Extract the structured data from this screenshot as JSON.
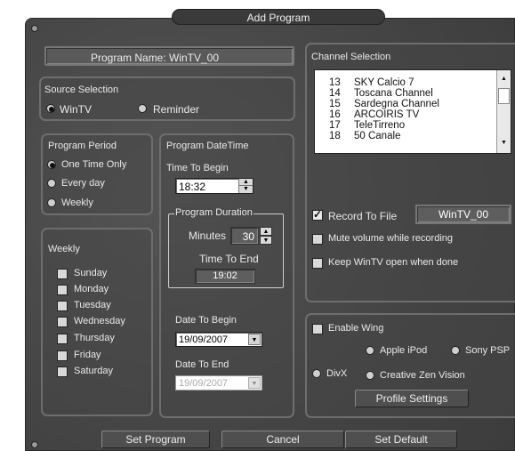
{
  "title": "Add Program",
  "program_name": {
    "label": "Program Name:",
    "value": "WinTV_00"
  },
  "source": {
    "title": "Source Selection",
    "options": [
      "WinTV",
      "Reminder"
    ],
    "selected": "WinTV"
  },
  "period": {
    "title": "Program Period",
    "options": [
      "One Time Only",
      "Every day",
      "Weekly"
    ],
    "selected": "One Time Only"
  },
  "weekly": {
    "title": "Weekly",
    "days": [
      "Sunday",
      "Monday",
      "Tuesday",
      "Wednesday",
      "Thursday",
      "Friday",
      "Saturday"
    ]
  },
  "datetime": {
    "title": "Program DateTime",
    "time_label": "Time To Begin",
    "time_value": "18:32",
    "duration_title": "Program Duration",
    "minutes_label": "Minutes",
    "minutes_value": "30",
    "end_label": "Time To End",
    "end_value": "19:02",
    "date_begin_label": "Date To Begin",
    "date_begin_value": "19/09/2007",
    "date_end_label": "Date To End",
    "date_end_value": "19/09/2007"
  },
  "channels": {
    "title": "Channel Selection",
    "items": [
      {
        "num": "13",
        "name": "SKY Calcio 7"
      },
      {
        "num": "14",
        "name": "Toscana Channel"
      },
      {
        "num": "15",
        "name": "Sardegna Channel"
      },
      {
        "num": "16",
        "name": "ARCOIRIS TV"
      },
      {
        "num": "17",
        "name": "TeleTirreno"
      },
      {
        "num": "18",
        "name": "50 Canale"
      }
    ]
  },
  "record": {
    "label": "Record To File",
    "checked": true,
    "file": "WinTV_00"
  },
  "mute": {
    "label": "Mute volume while recording",
    "checked": false
  },
  "keep_open": {
    "label": "Keep WinTV open when done",
    "checked": false
  },
  "wing": {
    "label": "Enable Wing",
    "checked": false,
    "apple": "Apple iPod",
    "sony": "Sony PSP",
    "divx": "DivX",
    "zen": "Creative Zen Vision",
    "profile_button": "Profile Settings"
  },
  "buttons": {
    "set": "Set Program",
    "cancel": "Cancel",
    "default": "Set Default"
  }
}
